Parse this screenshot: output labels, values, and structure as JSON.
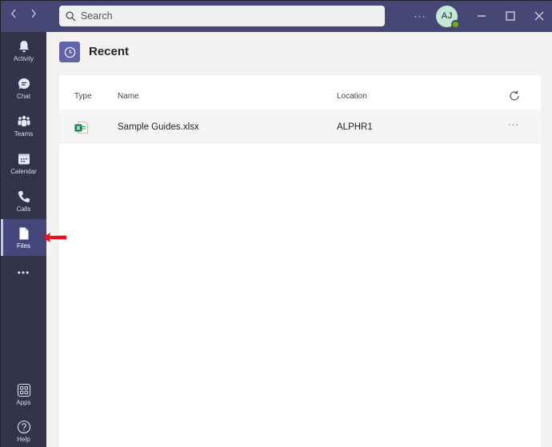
{
  "titlebar": {
    "back_label": "<",
    "forward_label": ">",
    "search_placeholder": "Search",
    "more_label": "···",
    "avatar_initials": "AJ",
    "presence_status": "available",
    "window_controls": [
      "minimize",
      "maximize",
      "close"
    ]
  },
  "rail": {
    "items": [
      {
        "label": "Activity",
        "icon": "bell-icon"
      },
      {
        "label": "Chat",
        "icon": "chat-icon"
      },
      {
        "label": "Teams",
        "icon": "teams-icon"
      },
      {
        "label": "Calendar",
        "icon": "calendar-icon"
      },
      {
        "label": "Calls",
        "icon": "phone-icon"
      },
      {
        "label": "Files",
        "icon": "file-icon",
        "active": true
      }
    ],
    "more_label": "•••",
    "bottom_items": [
      {
        "label": "Apps",
        "icon": "apps-icon"
      },
      {
        "label": "Help",
        "icon": "help-icon"
      }
    ]
  },
  "main": {
    "title": "Recent",
    "title_icon": "clock-icon",
    "columns": [
      "Type",
      "Name",
      "Location"
    ],
    "files": [
      {
        "type": "excel",
        "name": "Sample Guides.xlsx",
        "location": "ALPHR1"
      }
    ],
    "row_more_label": "···"
  },
  "colors": {
    "accent": "#6264a7",
    "titlebar": "#464775",
    "rail": "#33344a",
    "annotation_arrow": "#e81123"
  }
}
